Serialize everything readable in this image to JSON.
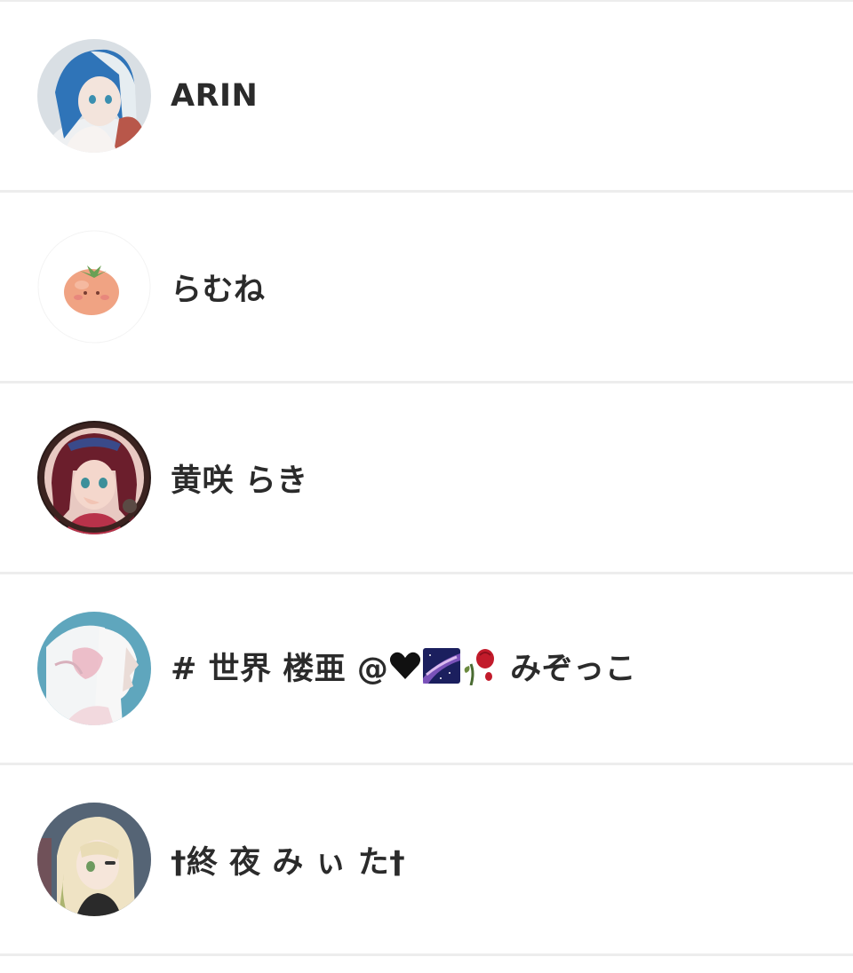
{
  "users": [
    {
      "name": "ARIN",
      "avatar": "avatar-blue-hair-girl",
      "colors": {
        "bg": "#d9dfe4",
        "hair": "#2f74b8",
        "hair_light": "#dfe8ee",
        "skin": "#f3e4dc"
      }
    },
    {
      "name": "らむね",
      "avatar": "avatar-tomato-mascot",
      "colors": {
        "bg": "#ffffff",
        "body": "#f0a383",
        "leaf": "#6aa055"
      }
    },
    {
      "name": "黄咲 らき",
      "avatar": "avatar-burgundy-hair-girl",
      "colors": {
        "bg": "#2a1a18",
        "hair": "#6b1e2c",
        "skin": "#f4d7cc"
      }
    },
    {
      "name_prefix": "# 世界 楼亜 @",
      "name_suffix": " みぞっこ",
      "emojis": [
        "black-heart-icon",
        "milky-way-icon",
        "wilted-rose-icon"
      ],
      "avatar": "avatar-white-hair-profile",
      "colors": {
        "bg": "#5fa6bd",
        "hair": "#f1f1f1",
        "accent": "#e8a7b6"
      }
    },
    {
      "name": "†終 夜 み ぃ た†",
      "avatar": "avatar-cream-hair-green-eye",
      "colors": {
        "bg": "#3d4e63",
        "hair": "#efe3c4",
        "accent": "#6d9a5f"
      }
    }
  ]
}
